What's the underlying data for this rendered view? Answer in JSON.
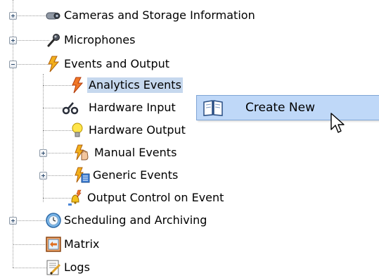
{
  "tree": {
    "items": [
      {
        "label": "Cameras and Storage Information",
        "icon": "camera-icon",
        "expander": "plus"
      },
      {
        "label": "Microphones",
        "icon": "microphone-icon",
        "expander": "plus"
      },
      {
        "label": "Events and Output",
        "icon": "lightning-icon",
        "expander": "minus"
      },
      {
        "label": "Analytics Events",
        "icon": "analytics-event-icon",
        "selected": true
      },
      {
        "label": "Hardware Input",
        "icon": "hardware-input-icon"
      },
      {
        "label": "Hardware Output",
        "icon": "lightbulb-icon"
      },
      {
        "label": "Manual Events",
        "icon": "manual-event-hand-icon",
        "expander": "plus"
      },
      {
        "label": "Generic Events",
        "icon": "generic-event-icon",
        "expander": "plus"
      },
      {
        "label": "Output Control on Event",
        "icon": "bell-icon"
      },
      {
        "label": "Scheduling and Archiving",
        "icon": "clock-icon",
        "expander": "plus"
      },
      {
        "label": "Matrix",
        "icon": "matrix-icon"
      },
      {
        "label": "Logs",
        "icon": "logs-icon"
      }
    ]
  },
  "context_menu": {
    "item_label": "Create New",
    "icon": "book-icon"
  },
  "colors": {
    "selection": "#c6d8ee",
    "menu_bg": "#bfd8f8",
    "menu_border": "#7fa5d5"
  }
}
